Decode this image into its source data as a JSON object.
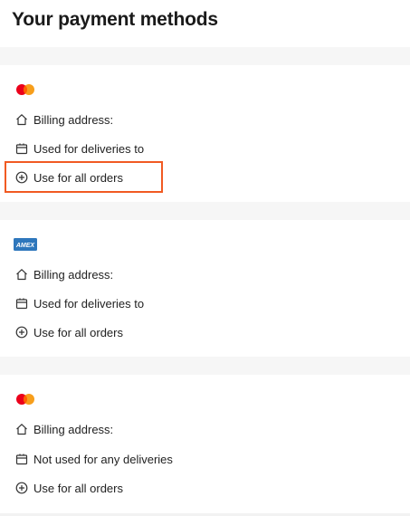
{
  "page": {
    "title": "Your payment methods"
  },
  "colors": {
    "highlight": "#f15a22",
    "mc_red": "#eb001b",
    "mc_orange": "#f79e1b",
    "amex_blue": "#2e77bc"
  },
  "payment_methods": [
    {
      "brand": "mastercard-logo",
      "billing_address_label": "Billing address:",
      "deliveries_label": "Used for deliveries to",
      "action_label": "Use for all orders"
    },
    {
      "brand": "amex-logo",
      "brand_text": "AMEX",
      "billing_address_label": "Billing address:",
      "deliveries_label": "Used for deliveries to",
      "action_label": "Use for all orders"
    },
    {
      "brand": "mastercard-logo",
      "billing_address_label": "Billing address:",
      "deliveries_label": "Not used for any deliveries",
      "action_label": "Use for all orders"
    }
  ]
}
